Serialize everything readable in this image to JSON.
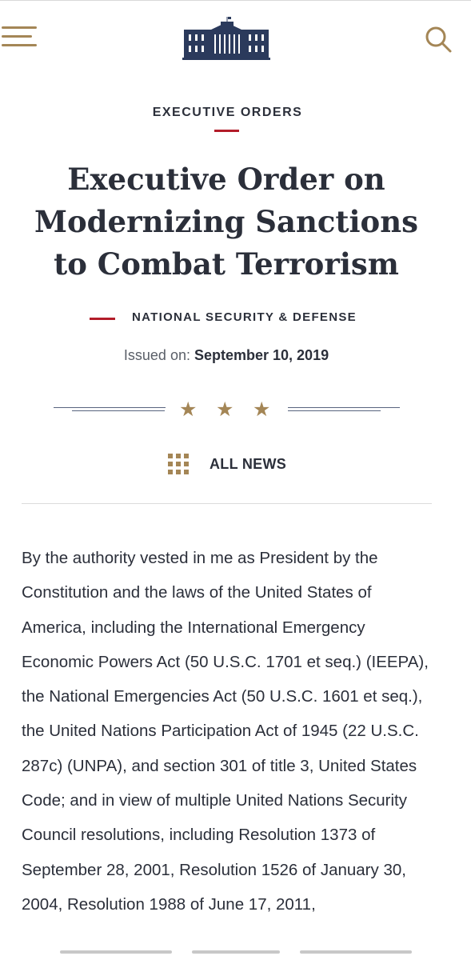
{
  "header": {
    "menu_icon": "hamburger-menu-icon",
    "logo_icon": "white-house-logo",
    "search_icon": "search-icon",
    "brand_color": "#a48656",
    "navy_color": "#2b2f3a",
    "accent_red": "#b31c29"
  },
  "article": {
    "kicker": "EXECUTIVE ORDERS",
    "title": "Executive Order on Modernizing Sanctions to Combat Terrorism",
    "category": "NATIONAL SECURITY & DEFENSE",
    "issued_label": "Issued on:",
    "issued_date": "September 10, 2019",
    "divider_icon": "three-stars-divider",
    "all_news_icon": "grid-icon",
    "all_news_label": "ALL NEWS",
    "body": "By the authority vested in me as President by the Constitution and the laws of the United States of America, including the International Emergency Economic Powers Act (50 U.S.C. 1701 et seq.) (IEEPA), the National Emergencies Act (50 U.S.C. 1601 et seq.), the United Nations Participation Act of 1945 (22 U.S.C. 287c) (UNPA), and section 301 of title 3, United States Code; and in view of multiple United Nations Security Council resolutions, including Resolution 1373 of September 28, 2001, Resolution 1526 of January 30, 2004, Resolution 1988 of June 17, 2011,"
  }
}
